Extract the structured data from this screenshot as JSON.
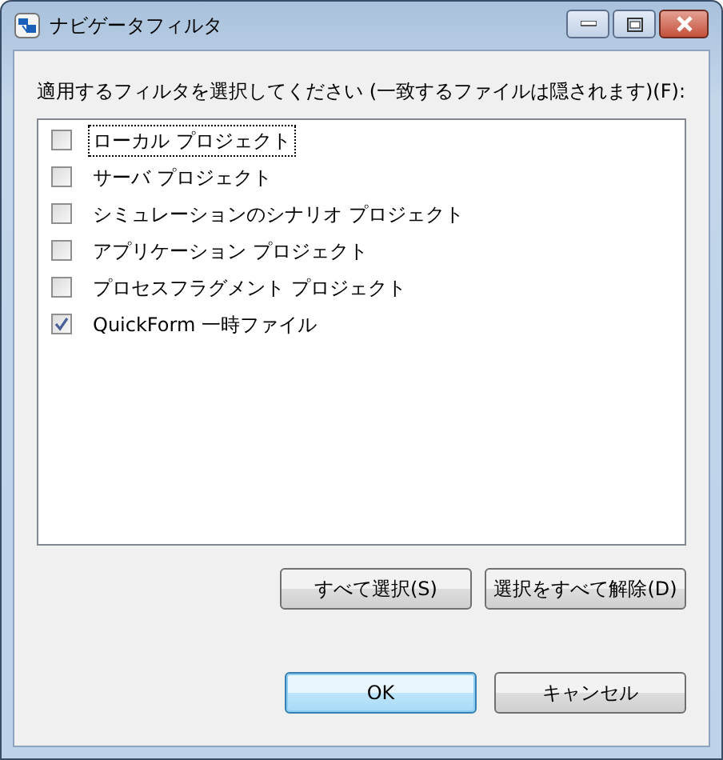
{
  "window": {
    "title": "ナビゲータフィルタ"
  },
  "prompt": "適用するフィルタを選択してください (一致するファイルは隠されます)(F):",
  "filters": [
    {
      "label": "ローカル プロジェクト",
      "checked": false,
      "focused": true
    },
    {
      "label": "サーバ プロジェクト",
      "checked": false,
      "focused": false
    },
    {
      "label": "シミュレーションのシナリオ プロジェクト",
      "checked": false,
      "focused": false
    },
    {
      "label": "アプリケーション プロジェクト",
      "checked": false,
      "focused": false
    },
    {
      "label": "プロセスフラグメント プロジェクト",
      "checked": false,
      "focused": false
    },
    {
      "label": "QuickForm 一時ファイル",
      "checked": true,
      "focused": false
    }
  ],
  "select_buttons": [
    "すべて選択(S)",
    "選択をすべて解除(D)"
  ],
  "dialog_buttons": [
    {
      "label": "OK",
      "default": true
    },
    {
      "label": "キャンセル",
      "default": false
    }
  ]
}
